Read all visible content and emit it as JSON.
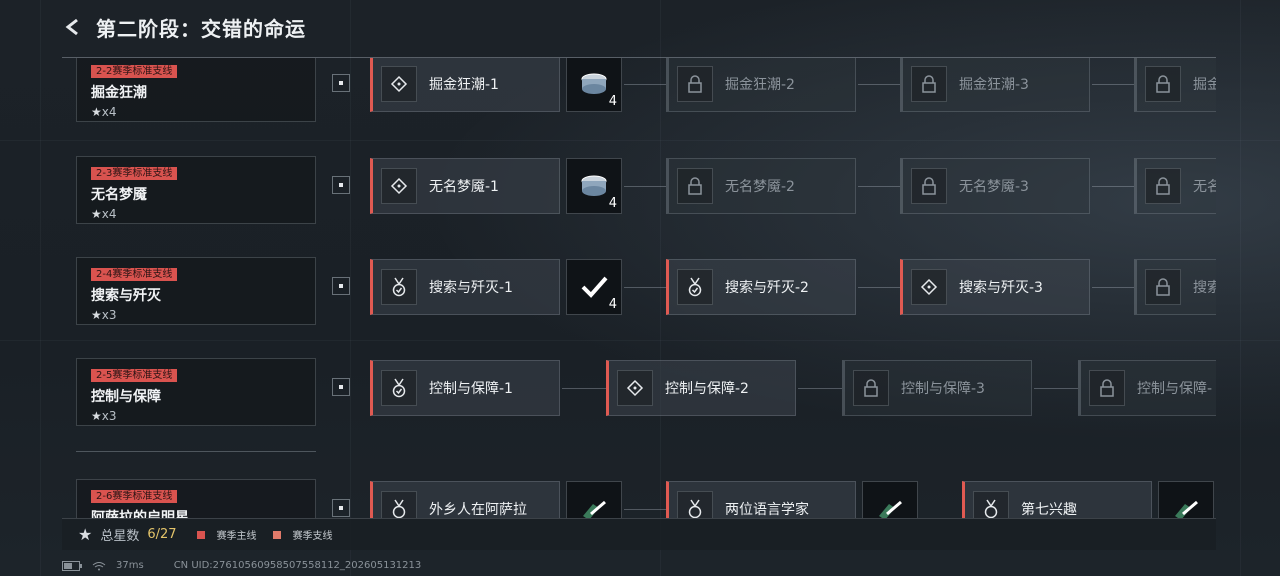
{
  "header": {
    "title": "第二阶段：交错的命运"
  },
  "rows": [
    {
      "tag": "2-2赛季标准支线",
      "name": "掘金狂潮",
      "stars": "x4",
      "nodes": [
        "掘金狂潮-1",
        "掘金狂潮-2",
        "掘金狂潮-3",
        "掘金"
      ],
      "reward_count": "4"
    },
    {
      "tag": "2-3赛季标准支线",
      "name": "无名梦魇",
      "stars": "x4",
      "nodes": [
        "无名梦魇-1",
        "无名梦魇-2",
        "无名梦魇-3",
        "无名"
      ],
      "reward_count": "4"
    },
    {
      "tag": "2-4赛季标准支线",
      "name": "搜索与歼灭",
      "stars": "x3",
      "nodes": [
        "搜索与歼灭-1",
        "搜索与歼灭-2",
        "搜索与歼灭-3",
        "搜索"
      ],
      "reward_count": "4"
    },
    {
      "tag": "2-5赛季标准支线",
      "name": "控制与保障",
      "stars": "x3",
      "nodes": [
        "控制与保障-1",
        "控制与保障-2",
        "控制与保障-3",
        "控制与保障-"
      ]
    },
    {
      "tag": "2-6赛季标准支线",
      "name": "阿萨拉的启明星",
      "nodes": [
        "外乡人在阿萨拉",
        "两位语言学家",
        "第七兴趣"
      ]
    }
  ],
  "footer": {
    "total_label": "总星数",
    "total_value": "6/27",
    "legend_main": "赛季主线",
    "legend_side": "赛季支线",
    "legend_main_color": "#d9534f",
    "legend_side_color": "#e07a6a"
  },
  "status": {
    "ping": "37ms",
    "uid": "CN UID:27610560958507558112_202605131213"
  }
}
